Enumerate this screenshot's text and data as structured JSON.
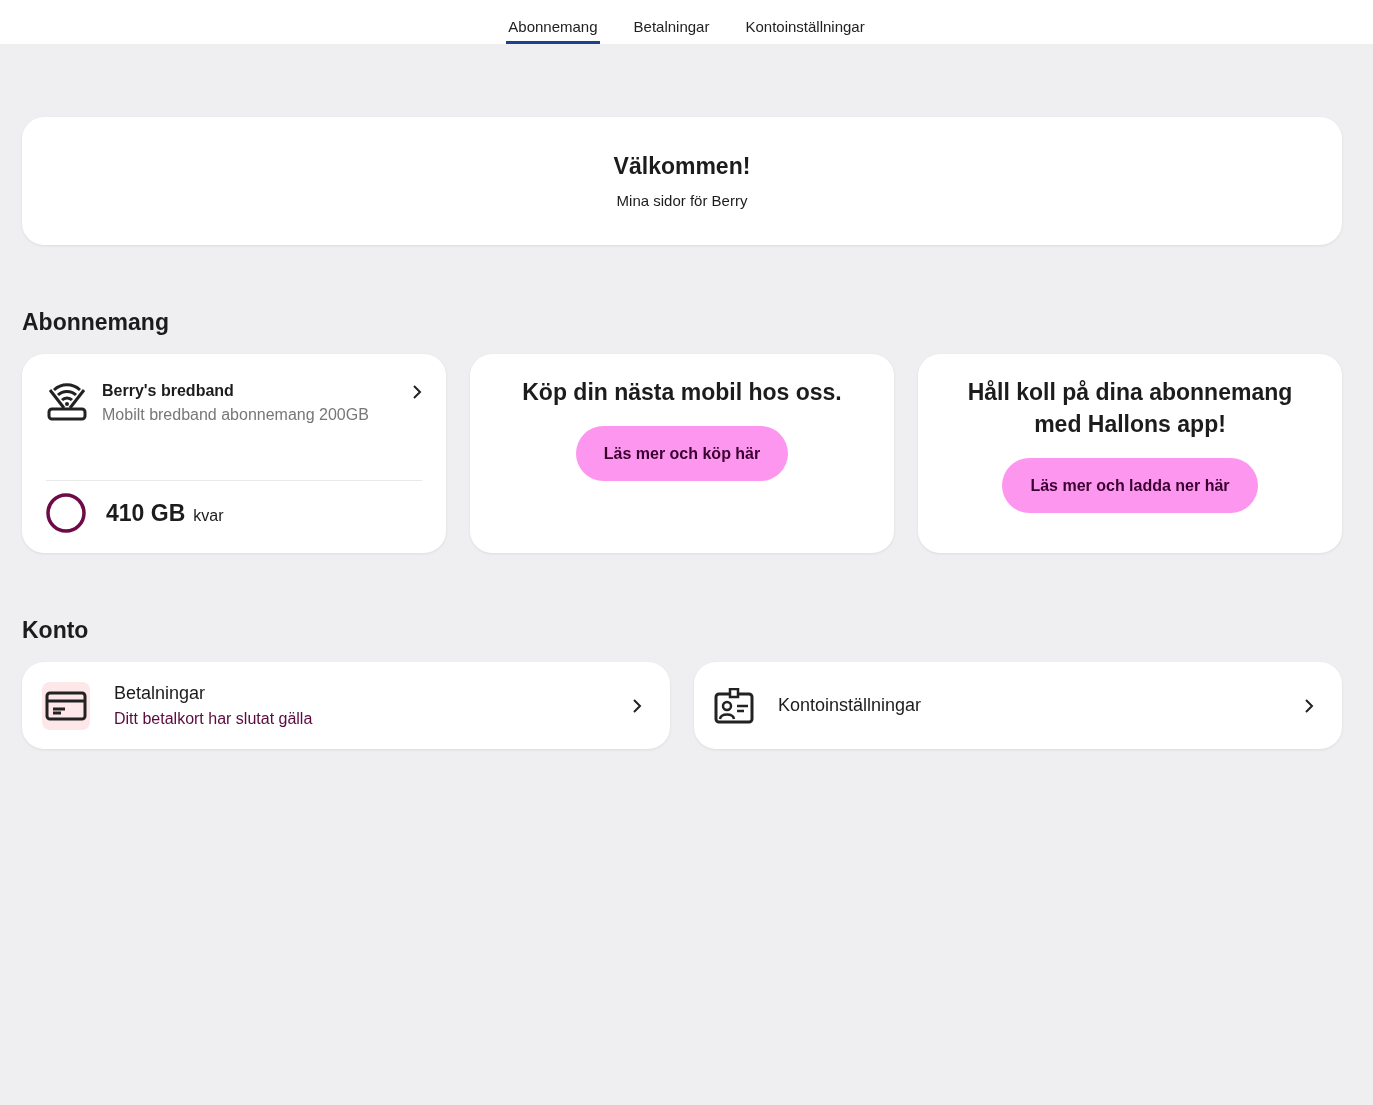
{
  "tabs": [
    {
      "label": "Abonnemang",
      "selected": true
    },
    {
      "label": "Betalningar",
      "selected": false
    },
    {
      "label": "Kontoinställningar",
      "selected": false
    }
  ],
  "welcome": {
    "title": "Välkommen!",
    "subtitle": "Mina sidor för Berry"
  },
  "subscriptions": {
    "heading": "Abonnemang",
    "product": {
      "name": "Berry's bredband",
      "plan": "Mobilt bredband abonnemang 200GB",
      "amount": "410 GB",
      "unit": "kvar"
    },
    "promos": [
      {
        "title": "Köp din nästa mobil hos oss.",
        "button": "Läs mer och köp här"
      },
      {
        "title": "Håll koll på dina abonnemang med Hallons app!",
        "button": "Läs mer och ladda ner här"
      }
    ]
  },
  "account": {
    "heading": "Konto",
    "items": [
      {
        "kind": "payment",
        "title": "Betalningar",
        "subtitle": "Ditt betalkort har slutat gälla"
      },
      {
        "kind": "settings",
        "title": "Kontoinställningar"
      }
    ]
  }
}
